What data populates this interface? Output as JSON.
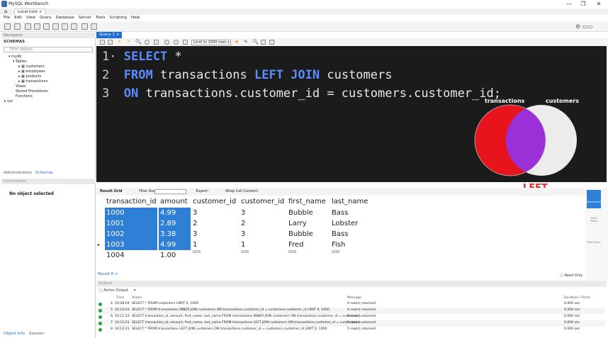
{
  "window": {
    "title": "MySQL Workbench",
    "connection_tab": "Local host",
    "minimize": "—",
    "maximize": "❐",
    "close": "✕"
  },
  "menu": [
    "File",
    "Edit",
    "View",
    "Query",
    "Database",
    "Server",
    "Tools",
    "Scripting",
    "Help"
  ],
  "sidebar": {
    "navigator_label": "Navigator",
    "schemas_label": "SCHEMAS",
    "filter_placeholder": "Filter objects",
    "tree": {
      "db": "mydb",
      "tables": "Tables",
      "items": [
        "customers",
        "employees",
        "products",
        "transactions"
      ],
      "views": "Views",
      "procedures": "Stored Procedures",
      "functions": "Functions",
      "sys": "sys"
    },
    "panel_tabs": [
      "Administration",
      "Schemas"
    ],
    "information_label": "Information",
    "no_object": "No object selected",
    "bottom_tabs": [
      "Object Info",
      "Session"
    ]
  },
  "query": {
    "tab_label": "Query 1",
    "limit_label": "Limit to 1000 rows",
    "lines": [
      {
        "num": "1",
        "dot": "·",
        "kw1": "SELECT",
        "rest": " *",
        "kw2": "",
        "rest2": ""
      },
      {
        "num": "2",
        "dot": " ",
        "kw1": "FROM",
        "rest": " transactions ",
        "kw2": "LEFT JOIN",
        "rest2": " customers"
      },
      {
        "num": "3",
        "dot": " ",
        "kw1": "ON",
        "rest": " transactions.customer_id = customers.customer_id;",
        "kw2": "",
        "rest2": ""
      }
    ]
  },
  "venn": {
    "left_label": "transactions",
    "right_label": "customers",
    "join_label": "LEFT",
    "left_color": "#e8141c",
    "overlap_color": "#9b30d9",
    "right_color": "#ececec"
  },
  "results": {
    "toolbar": {
      "result_grid": "Result Grid",
      "filter_rows": "Filter Rows:",
      "export": "Export:",
      "wrap": "Wrap Cell Content:"
    },
    "columns": [
      "transaction_id",
      "amount",
      "customer_id",
      "customer_id",
      "first_name",
      "last_name"
    ],
    "rows": [
      [
        "1000",
        "4.99",
        "3",
        "3",
        "Bubble",
        "Bass"
      ],
      [
        "1001",
        "2.89",
        "2",
        "2",
        "Larry",
        "Lobster"
      ],
      [
        "1002",
        "3.38",
        "3",
        "3",
        "Bubble",
        "Bass"
      ],
      [
        "1003",
        "4.99",
        "1",
        "1",
        "Fred",
        "Fish"
      ],
      [
        "1004",
        "1.00",
        "",
        "",
        "",
        ""
      ]
    ],
    "null_badge": "NULL",
    "right_panel": [
      "Result Grid",
      "Form Editor",
      "Field Types"
    ],
    "result_tab": "Result 6",
    "read_only": "Read Only"
  },
  "output": {
    "header": "Output",
    "action_output": "Action Output",
    "columns": [
      "Time",
      "Action",
      "Message",
      "Duration / Fetch"
    ],
    "rows": [
      {
        "n": "4",
        "time": "10:08:04",
        "action": "SELECT * FROM customers LIMIT 0, 1000",
        "msg": "4 row(s) returned",
        "dur": "0.000 sec"
      },
      {
        "n": "5",
        "time": "10:10:03",
        "action": "SELECT * FROM transactions INNER JOIN customers ON transactions.customer_id = customers.customer_id LIMIT 0, 1000",
        "msg": "4 row(s) returned",
        "dur": "0.000 sec"
      },
      {
        "n": "6",
        "time": "10:11:33",
        "action": "SELECT transaction_id, amount, first_name, last_name FROM transactions INNER JOIN customers ON transactions.customer_id = customers...",
        "msg": "4 row(s) returned",
        "dur": "0.000 sec"
      },
      {
        "n": "7",
        "time": "10:12:21",
        "action": "SELECT transaction_id, amount, first_name, last_name FROM transactions LEFT JOIN customers ON transactions.customer_id = customers.c...",
        "msg": "5 row(s) returned",
        "dur": "0.000 sec"
      },
      {
        "n": "8",
        "time": "10:12:31",
        "action": "SELECT * FROM transactions LEFT JOIN customers ON transactions.customer_id = customers.customer_id LIMIT 0, 1000",
        "msg": "5 row(s) returned",
        "dur": "0.000 sec"
      }
    ]
  }
}
